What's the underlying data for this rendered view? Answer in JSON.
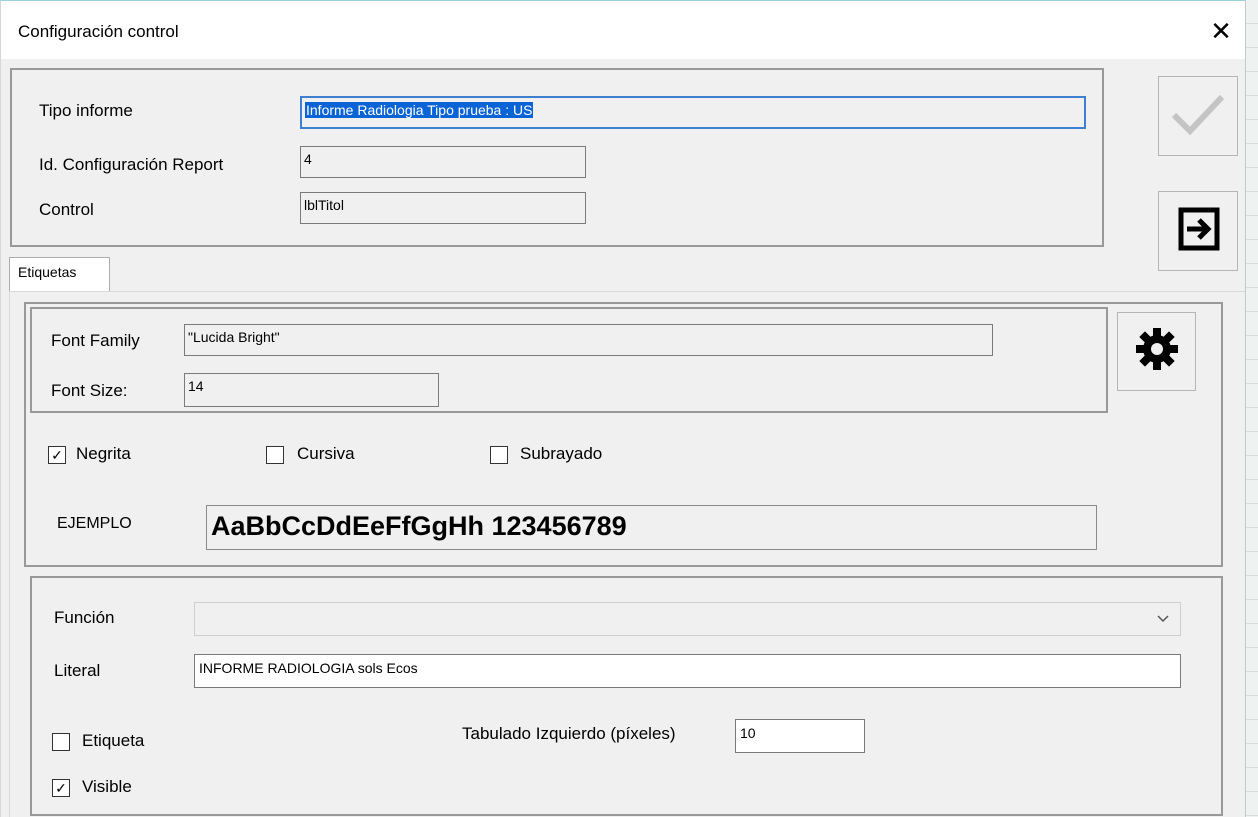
{
  "window": {
    "title": "Configuración control",
    "close_symbol": "✕"
  },
  "header_group": {
    "tipo_informe_label": "Tipo informe",
    "tipo_informe_value": "Informe Radiologia Tipo prueba : US",
    "id_config_label": "Id. Configuración Report",
    "id_config_value": "4",
    "control_label": "Control",
    "control_value": "lblTitol"
  },
  "side_buttons": {
    "accept_icon": "check-icon",
    "exit_icon": "exit-icon",
    "settings_icon": "gear-icon"
  },
  "tabs": [
    {
      "label": "Etiquetas",
      "active": true
    }
  ],
  "font_group": {
    "family_label": "Font Family",
    "family_value": "\"Lucida Bright\"",
    "size_label": "Font Size:",
    "size_value": "14"
  },
  "style_options": {
    "bold_label": "Negrita",
    "bold_checked": true,
    "italic_label": "Cursiva",
    "italic_checked": false,
    "underline_label": "Subrayado",
    "underline_checked": false
  },
  "sample": {
    "label": "EJEMPLO",
    "text": "AaBbCcDdEeFfGgHh 123456789"
  },
  "details_group": {
    "funcion_label": "Función",
    "funcion_value": "",
    "literal_label": "Literal",
    "literal_value": "INFORME RADIOLOGIA sols Ecos",
    "etiqueta_label": "Etiqueta",
    "etiqueta_checked": false,
    "visible_label": "Visible",
    "visible_checked": true,
    "tab_left_label": "Tabulado Izquierdo (píxeles)",
    "tab_left_value": "10"
  },
  "check_mark": "✓",
  "colors": {
    "selection": "#0a64d6",
    "panel": "#f0f0f0",
    "accent_border": "#3f7fd0"
  }
}
